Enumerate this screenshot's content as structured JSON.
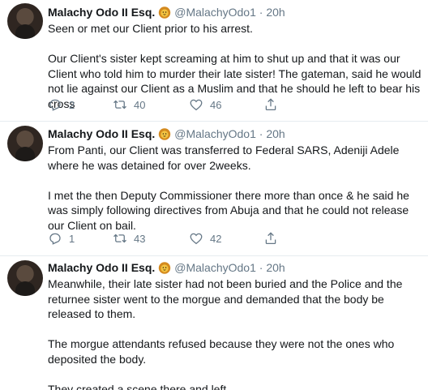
{
  "tweets": [
    {
      "name": "Malachy Odo II Esq.",
      "badge_icon": "lion-face-icon",
      "handle": "@MalachyOdo1",
      "separator": "·",
      "time": "20h",
      "paragraphs": [
        "Seen or met our Client prior to his arrest.",
        "Our Client's sister kept screaming at him to shut up and that it was our Client who told him to murder their late sister! The gateman, said he would not lie against our Client as a Muslim and that he should he left to bear his cross"
      ],
      "replies": "2",
      "retweets": "40",
      "likes": "46"
    },
    {
      "name": "Malachy Odo II Esq.",
      "badge_icon": "lion-face-icon",
      "handle": "@MalachyOdo1",
      "separator": "·",
      "time": "20h",
      "paragraphs": [
        "From Panti, our Client was transferred to Federal SARS, Adeniji Adele where he was detained for over 2weeks.",
        "I met the then Deputy Commissioner there more than once & he said he was simply following directives from Abuja and that he could not release our Client on bail."
      ],
      "replies": "1",
      "retweets": "43",
      "likes": "42"
    },
    {
      "name": "Malachy Odo II Esq.",
      "badge_icon": "lion-face-icon",
      "handle": "@MalachyOdo1",
      "separator": "·",
      "time": "20h",
      "paragraphs": [
        "Meanwhile, their late sister had not been buried and the Police and the returnee sister went to the morgue and demanded that the body be released to them.",
        "The morgue attendants refused because they were not the ones who deposited the body.",
        "They created a scene there and left"
      ]
    }
  ],
  "icons": {
    "reply": "reply-icon",
    "retweet": "retweet-icon",
    "like": "heart-icon",
    "share": "share-icon"
  }
}
